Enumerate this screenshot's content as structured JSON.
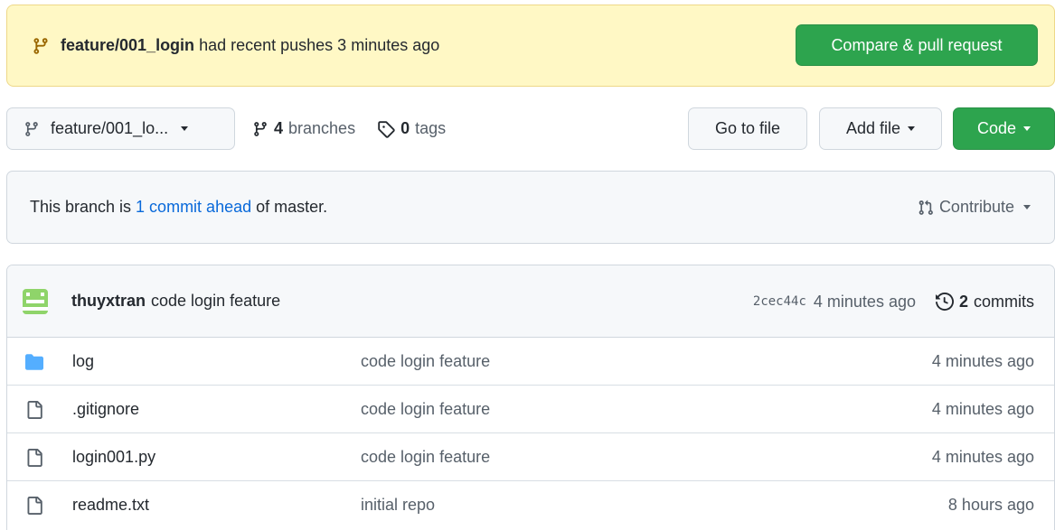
{
  "banner": {
    "branch": "feature/001_login",
    "text": "had recent pushes 3 minutes ago",
    "button": "Compare & pull request"
  },
  "toolbar": {
    "branch_select": "feature/001_lo...",
    "branches_count": "4",
    "branches_label": "branches",
    "tags_count": "0",
    "tags_label": "tags",
    "go_to_file": "Go to file",
    "add_file": "Add file",
    "code": "Code"
  },
  "ahead": {
    "prefix": "This branch is",
    "link": "1 commit ahead",
    "suffix": "of master.",
    "contribute": "Contribute"
  },
  "commit": {
    "author": "thuyxtran",
    "message": "code login feature",
    "sha": "2cec44c",
    "age": "4 minutes ago",
    "commits_count": "2",
    "commits_label": "commits"
  },
  "files": [
    {
      "type": "folder",
      "name": "log",
      "message": "code login feature",
      "age": "4 minutes ago"
    },
    {
      "type": "file",
      "name": ".gitignore",
      "message": "code login feature",
      "age": "4 minutes ago"
    },
    {
      "type": "file",
      "name": "login001.py",
      "message": "code login feature",
      "age": "4 minutes ago"
    },
    {
      "type": "file",
      "name": "readme.txt",
      "message": "initial repo",
      "age": "8 hours ago"
    }
  ],
  "colors": {
    "green": "#2da44e",
    "link_blue": "#0969da",
    "banner_bg": "#fff8c5",
    "folder_blue": "#54aeff",
    "avatar_green": "#8fd46a"
  }
}
